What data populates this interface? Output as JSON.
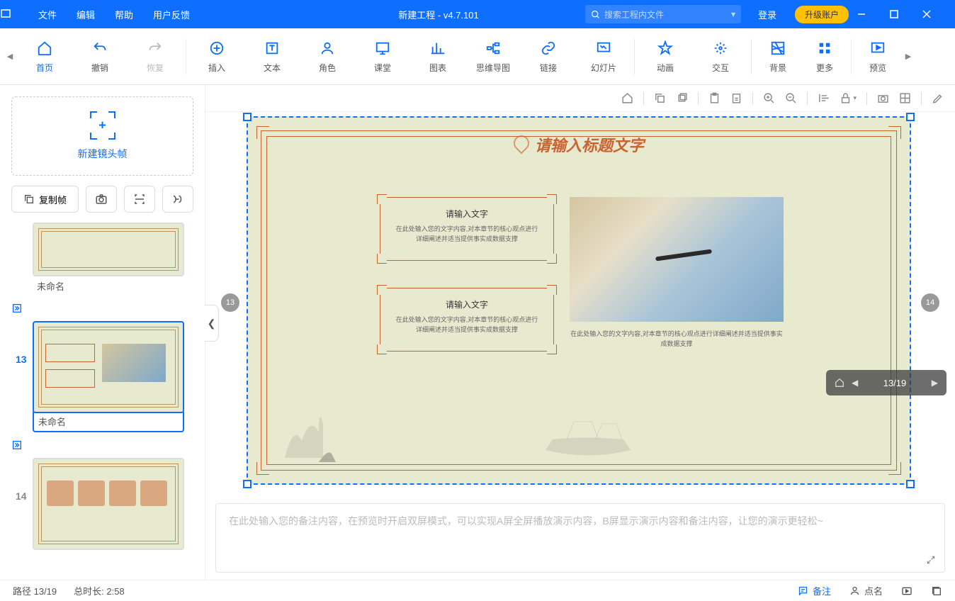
{
  "titlebar": {
    "menus": {
      "file": "文件",
      "edit": "编辑",
      "help": "帮助",
      "feedback": "用户反馈"
    },
    "title": "新建工程 - v4.7.101",
    "search_placeholder": "搜索工程内文件",
    "login": "登录",
    "upgrade": "升级账户"
  },
  "toolbar": {
    "home": "首页",
    "undo": "撤销",
    "redo": "恢复",
    "insert": "插入",
    "text": "文本",
    "role": "角色",
    "class": "课堂",
    "chart": "图表",
    "mindmap": "思维导图",
    "link": "链接",
    "slide": "幻灯片",
    "animation": "动画",
    "interact": "交互",
    "background": "背景",
    "more": "更多",
    "preview": "预览"
  },
  "sidebar": {
    "new_frame": "新建镜头帧",
    "copy_frame": "复制帧",
    "thumb_unnamed": "未命名",
    "indices": {
      "current": "13",
      "next": "14"
    }
  },
  "canvas": {
    "slide_title": "请输入标题文字",
    "box_title": "请输入文字",
    "box_body": "在此处输入您的文字内容,对本章节的核心观点进行详细阐述并适当提供事实成数据支撑",
    "nav_prev": "13",
    "nav_next": "14",
    "mini_counter": "13/19"
  },
  "notes": {
    "placeholder": "在此处输入您的备注内容，在预览时开启双屏模式，可以实现A屏全屏播放演示内容，B屏显示演示内容和备注内容，让您的演示更轻松~"
  },
  "status": {
    "path": "路径 13/19",
    "duration": "总时长: 2:58",
    "notes_btn": "备注",
    "roll_btn": "点名"
  }
}
